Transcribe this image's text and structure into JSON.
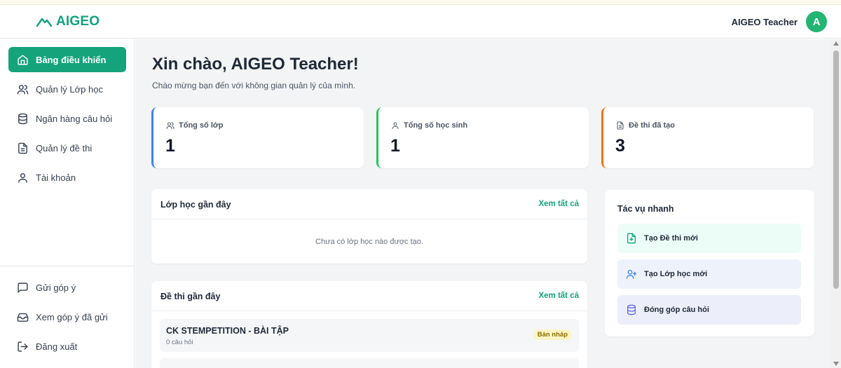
{
  "colors": {
    "brand": "#15a37c",
    "blue": "#3b82f6",
    "green": "#22c55e",
    "orange": "#f97316"
  },
  "header": {
    "logo_text": "AIGEO",
    "user_name": "AIGEO Teacher",
    "avatar_letter": "A"
  },
  "sidebar": {
    "items": [
      {
        "label": "Bảng điều khiển",
        "icon": "home-icon",
        "active": true
      },
      {
        "label": "Quản lý Lớp học",
        "icon": "users-icon"
      },
      {
        "label": "Ngân hàng câu hỏi",
        "icon": "database-icon"
      },
      {
        "label": "Quản lý đề thi",
        "icon": "file-text-icon"
      },
      {
        "label": "Tài khoản",
        "icon": "user-icon"
      }
    ],
    "bottom": [
      {
        "label": "Gửi góp ý",
        "icon": "message-square-icon"
      },
      {
        "label": "Xem góp ý đã gửi",
        "icon": "inbox-icon"
      },
      {
        "label": "Đăng xuất",
        "icon": "log-out-icon"
      }
    ]
  },
  "main": {
    "greeting": "Xin chào, AIGEO Teacher!",
    "subtitle": "Chào mừng bạn đến với không gian quản lý của mình.",
    "stats": [
      {
        "label": "Tổng số lớp",
        "value": "1",
        "icon": "users-icon",
        "color": "#3b82f6"
      },
      {
        "label": "Tổng số học sinh",
        "value": "1",
        "icon": "user-icon",
        "color": "#22c55e"
      },
      {
        "label": "Đề thi đã tạo",
        "value": "3",
        "icon": "file-text-icon",
        "color": "#f97316"
      }
    ],
    "recent_classes": {
      "title": "Lớp học gần đây",
      "link": "Xem tất cả",
      "empty": "Chưa có lớp học nào được tạo."
    },
    "recent_exams": {
      "title": "Đề thi gần đây",
      "link": "Xem tất cả",
      "items": [
        {
          "title": "CK STEMPETITION - BÀI TẬP",
          "subtitle": "0 câu hỏi",
          "status": "Bản nháp"
        }
      ]
    },
    "quick_actions": {
      "title": "Tác vụ nhanh",
      "items": [
        {
          "label": "Tạo Đề thi mới",
          "icon": "file-plus-icon",
          "bg": "#ecfdf7",
          "color": "#15a37c"
        },
        {
          "label": "Tạo Lớp học mới",
          "icon": "user-plus-icon",
          "bg": "#eef2fb",
          "color": "#3b82f6"
        },
        {
          "label": "Đóng góp câu hỏi",
          "icon": "database-icon",
          "bg": "#eceef9",
          "color": "#6366f1"
        }
      ]
    }
  }
}
